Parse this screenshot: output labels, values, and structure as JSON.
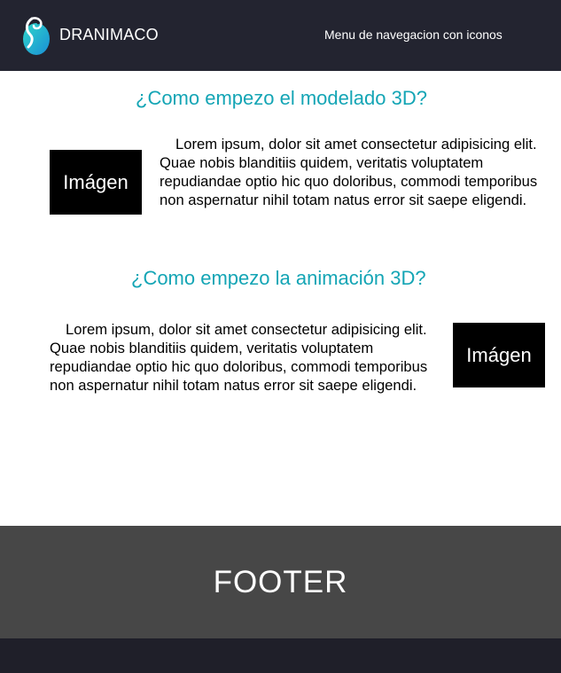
{
  "header": {
    "brand": "DRANIMACO",
    "nav_text": "Menu de navegacion con iconos",
    "logo_icon": "dragon-logo-icon"
  },
  "sections": [
    {
      "title": "¿Como empezo el modelado 3D?",
      "image_label": "Imágen",
      "paragraph": "Lorem ipsum, dolor sit amet consectetur adipisicing elit. Quae nobis blanditiis quidem, veritatis voluptatem repudiandae optio hic quo doloribus, commodi temporibus non aspernatur nihil totam natus error sit saepe eligendi."
    },
    {
      "title": "¿Como empezo la animación 3D?",
      "image_label": "Imágen",
      "paragraph": "Lorem ipsum, dolor sit amet consectetur adipisicing elit. Quae nobis blanditiis quidem, veritatis voluptatem repudiandae optio hic quo doloribus, commodi temporibus non aspernatur nihil totam natus error sit saepe eligendi."
    }
  ],
  "footer": {
    "label": "FOOTER"
  },
  "colors": {
    "header_bg": "#232430",
    "title_accent": "#14a5b5",
    "footer_bg": "#474747",
    "logo_teal": "#23c3d3"
  }
}
